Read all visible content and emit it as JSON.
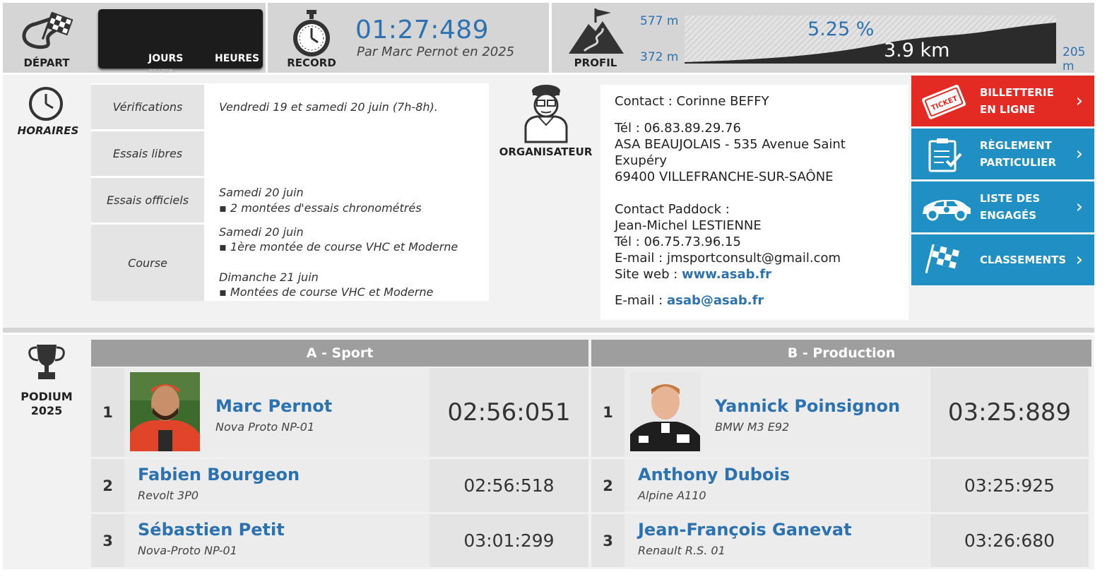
{
  "top": {
    "depart_label": "DÉPART",
    "countdown_days": "JOURS",
    "countdown_hours": "HEURES",
    "countdown_minutes_partial": "MINS",
    "record_label": "RECORD",
    "record_time": "01:27:489",
    "record_by": "Par Marc Pernot en 2025",
    "profil_label": "PROFIL",
    "alt_top": "577 m",
    "alt_bottom": "372 m",
    "slope": "5.25 %",
    "length": "3.9 km",
    "denivele": "205 m"
  },
  "horaires": {
    "label": "HORAIRES",
    "rows": [
      {
        "name": "Vérifications",
        "line1": "Vendredi 19 et samedi 20 juin (7h-8h).",
        "line2": "",
        "line3": "",
        "line4": ""
      },
      {
        "name": "Essais libres",
        "line1": "",
        "line2": "",
        "line3": "",
        "line4": ""
      },
      {
        "name": "Essais officiels",
        "line1": "Samedi 20 juin",
        "line2": "▪ 2 montées d'essais chronométrés",
        "line3": "",
        "line4": ""
      },
      {
        "name": "Course",
        "line1": "Samedi 20 juin",
        "line2": "▪ 1ère montée de course VHC et Moderne",
        "line3": "Dimanche 21 juin",
        "line4": "▪ Montées de course VHC et Moderne"
      }
    ]
  },
  "organisateur": {
    "label": "ORGANISATEUR",
    "contact": "Contact : Corinne BEFFY",
    "tel": "Tél : 06.83.89.29.76",
    "addr1": "ASA BEAUJOLAIS - 535 Avenue Saint",
    "addr2": "Exupéry",
    "addr3": "69400 VILLEFRANCHE-SUR-SAÔNE",
    "paddock_label": "Contact Paddock :",
    "paddock_name": "Jean-Michel LESTIENNE",
    "paddock_tel": "Tél : 06.75.73.96.15",
    "email_line": "E-mail : jmsportconsult@gmail.com",
    "site_prefix": "Site web : ",
    "site_link": "www.asab.fr",
    "email2_prefix": "E-mail : ",
    "email2_link": "asab@asab.fr"
  },
  "buttons": [
    {
      "line1": "BILLETTERIE",
      "line2": "EN LIGNE",
      "color": "#e32b24",
      "icon": "ticket-icon"
    },
    {
      "line1": "RÈGLEMENT",
      "line2": "PARTICULIER",
      "color": "#1f8fc4",
      "icon": "clipboard-icon"
    },
    {
      "line1": "LISTE DES",
      "line2": "ENGAGÉS",
      "color": "#1f8fc4",
      "icon": "race-car-icon"
    },
    {
      "line1": "CLASSEMENTS",
      "line2": "",
      "color": "#1f8fc4",
      "icon": "checkered-flag-icon"
    }
  ],
  "podium": {
    "label": "PODIUM",
    "year": "2025",
    "groups": [
      {
        "title": "A - Sport",
        "entries": [
          {
            "rank": "1",
            "name": "Marc Pernot",
            "car": "Nova Proto NP-01",
            "time": "02:56:051"
          },
          {
            "rank": "2",
            "name": "Fabien Bourgeon",
            "car": "Revolt 3P0",
            "time": "02:56:518"
          },
          {
            "rank": "3",
            "name": "Sébastien Petit",
            "car": "Nova-Proto NP-01",
            "time": "03:01:299"
          }
        ]
      },
      {
        "title": "B - Production",
        "entries": [
          {
            "rank": "1",
            "name": "Yannick Poinsignon",
            "car": "BMW M3 E92",
            "time": "03:25:889"
          },
          {
            "rank": "2",
            "name": "Anthony Dubois",
            "car": "Alpine A110",
            "time": "03:25:925"
          },
          {
            "rank": "3",
            "name": "Jean-François Ganevat",
            "car": "Renault R.S. 01",
            "time": "03:26:680"
          }
        ]
      }
    ]
  }
}
